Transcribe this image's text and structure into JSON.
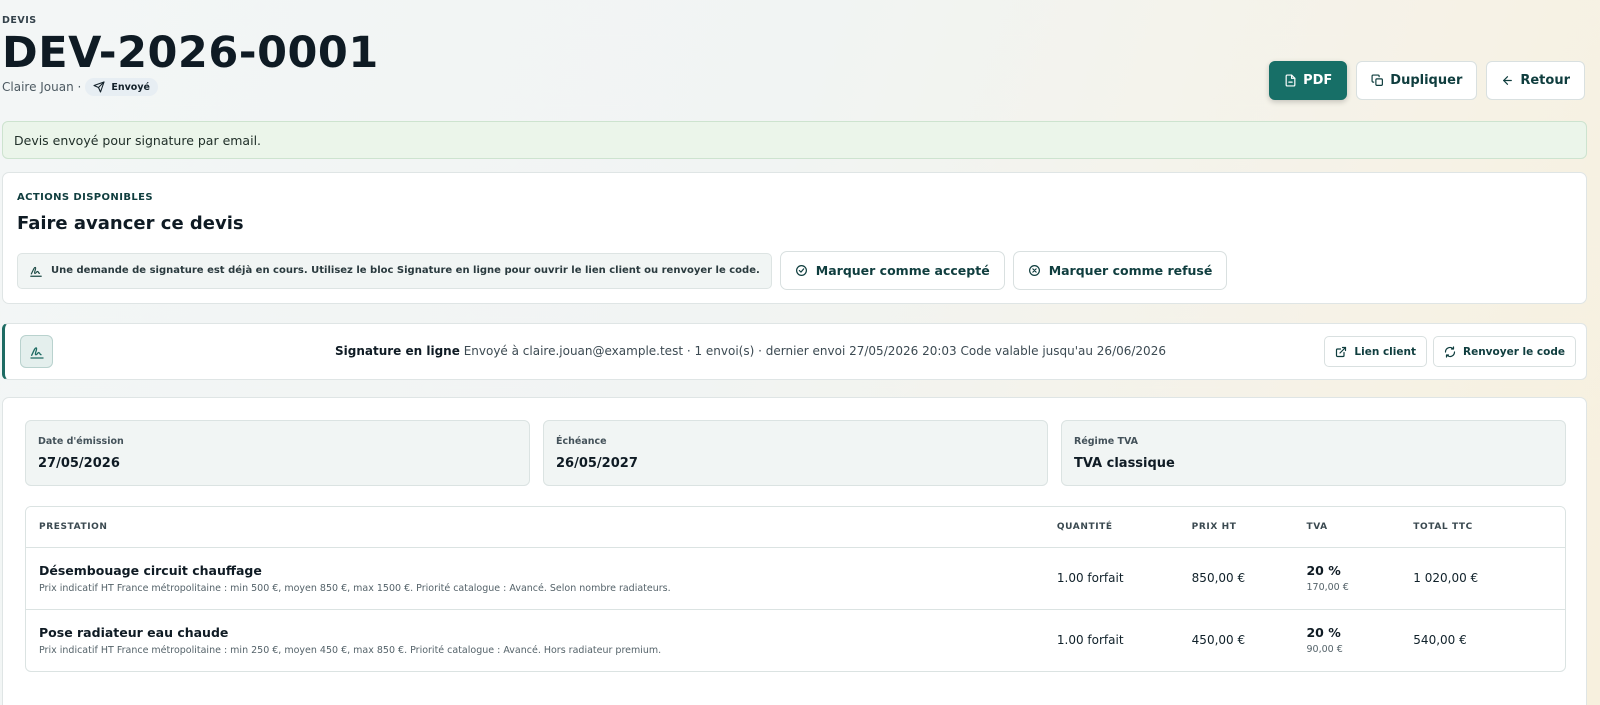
{
  "header": {
    "eyebrow": "DEVIS",
    "title": "DEV-2026-0001",
    "client": "Claire Jouan ·",
    "status_badge": "Envoyé",
    "buttons": {
      "pdf": "PDF",
      "duplicate": "Dupliquer",
      "back": "Retour"
    }
  },
  "alert": {
    "message": "Devis envoyé pour signature par email."
  },
  "actions_card": {
    "eyebrow": "ACTIONS DISPONIBLES",
    "title": "Faire avancer ce devis",
    "notice": "Une demande de signature est déjà en cours. Utilisez le bloc Signature en ligne pour ouvrir le lien client ou renvoyer le code.",
    "accept_label": "Marquer comme accepté",
    "refuse_label": "Marquer comme refusé"
  },
  "signature": {
    "title": "Signature en ligne",
    "details": "Envoyé à claire.jouan@example.test · 1 envoi(s) · dernier envoi 27/05/2026 20:03 Code valable jusqu'au 26/06/2026",
    "client_link_label": "Lien client",
    "resend_label": "Renvoyer le code"
  },
  "meta": [
    {
      "label": "Date d'émission",
      "value": "27/05/2026"
    },
    {
      "label": "Échéance",
      "value": "26/05/2027"
    },
    {
      "label": "Régime TVA",
      "value": "TVA classique"
    }
  ],
  "table": {
    "headers": {
      "prestation": "PRESTATION",
      "quantite": "QUANTITÉ",
      "prix_ht": "PRIX HT",
      "tva": "TVA",
      "total_ttc": "TOTAL TTC"
    },
    "rows": [
      {
        "title": "Désembouage circuit chauffage",
        "description": "Prix indicatif HT France métropolitaine : min 500 €, moyen 850 €, max 1500 €. Priorité catalogue : Avancé. Selon nombre radiateurs.",
        "quantity": "1.00 forfait",
        "price_ht": "850,00 €",
        "tva_rate": "20 %",
        "tva_amount": "170,00 €",
        "total_ttc": "1 020,00 €"
      },
      {
        "title": "Pose radiateur eau chaude",
        "description": "Prix indicatif HT France métropolitaine : min 250 €, moyen 450 €, max 850 €. Priorité catalogue : Avancé. Hors radiateur premium.",
        "quantity": "1.00 forfait",
        "price_ht": "450,00 €",
        "tva_rate": "20 %",
        "tva_amount": "90,00 €",
        "total_ttc": "540,00 €"
      }
    ]
  },
  "colors": {
    "primary": "#176f67",
    "accent_text": "#0f3d3e",
    "alert_bg": "#ebf5ea"
  },
  "icons": [
    "file-icon",
    "copy-icon",
    "arrow-left-icon",
    "send-icon",
    "signature-icon",
    "check-circle-icon",
    "x-circle-icon",
    "external-link-icon",
    "refresh-icon"
  ]
}
